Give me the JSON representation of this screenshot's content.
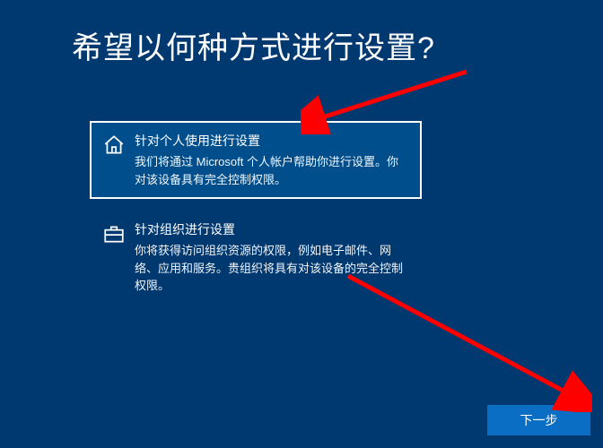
{
  "title": "希望以何种方式进行设置?",
  "options": [
    {
      "title": "针对个人使用进行设置",
      "desc": "我们将通过 Microsoft 个人帐户帮助你进行设置。你对该设备具有完全控制权限。"
    },
    {
      "title": "针对组织进行设置",
      "desc": "你将获得访问组织资源的权限，例如电子邮件、网络、应用和服务。贵组织将具有对该设备的完全控制权限。"
    }
  ],
  "next_label": "下一步"
}
